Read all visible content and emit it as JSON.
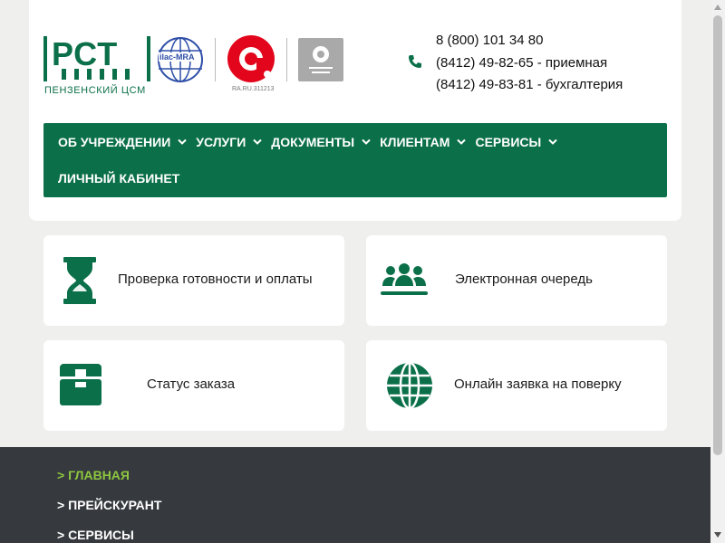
{
  "header": {
    "logo": {
      "brand": "РСТ",
      "subtitle": "ПЕНЗЕНСКИЙ ЦСМ",
      "ilac_text": "ilac-MRA",
      "accreditation_number": "RA.RU.311213"
    },
    "phones": [
      "8 (800) 101 34 80",
      "(8412) 49-82-65 - приемная",
      "(8412) 49-83-81 - бухгалтерия"
    ]
  },
  "nav": {
    "items": [
      {
        "label": "ОБ УЧРЕЖДЕНИИ",
        "dropdown": true
      },
      {
        "label": "УСЛУГИ",
        "dropdown": true
      },
      {
        "label": "ДОКУМЕНТЫ",
        "dropdown": true
      },
      {
        "label": "КЛИЕНТАМ",
        "dropdown": true
      },
      {
        "label": "СЕРВИСЫ",
        "dropdown": true
      },
      {
        "label": "ЛИЧНЫЙ КАБИНЕТ",
        "dropdown": false
      }
    ]
  },
  "services": [
    {
      "label": "Проверка готовности и оплаты",
      "icon": "hourglass-icon"
    },
    {
      "label": "Электронная очередь",
      "icon": "people-queue-icon"
    },
    {
      "label": "Статус заказа",
      "icon": "box-icon"
    },
    {
      "label": "Онлайн заявка на поверку",
      "icon": "globe-icon"
    }
  ],
  "footer": {
    "links": [
      {
        "label": "> ГЛАВНАЯ",
        "active": true
      },
      {
        "label": "> ПРЕЙСКУРАНТ",
        "active": false
      },
      {
        "label": "> СЕРВИСЫ",
        "active": false
      }
    ]
  },
  "colors": {
    "brand_green": "#0b7049",
    "footer_bg": "#363a3e",
    "active_link": "#8dc63f",
    "page_bg": "#efefed"
  }
}
